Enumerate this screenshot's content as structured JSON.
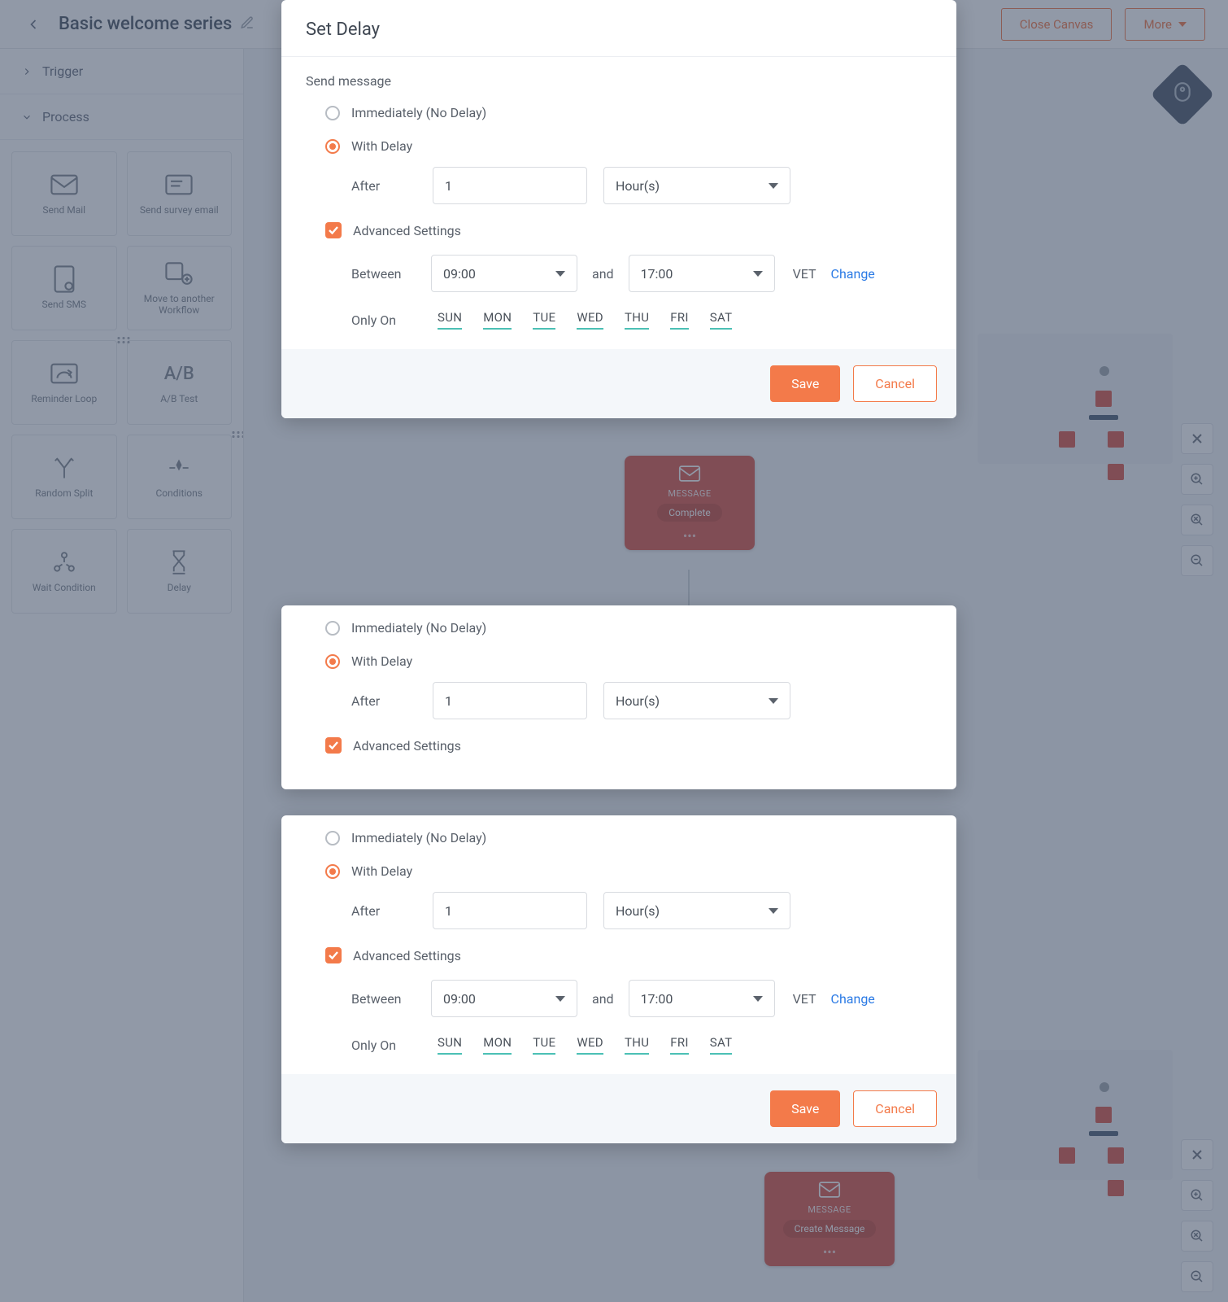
{
  "topbar": {
    "title": "Basic welcome series",
    "close_btn": "Close Canvas",
    "more_btn": "More"
  },
  "sidebar": {
    "section_trigger": "Trigger",
    "section_process": "Process",
    "tiles": [
      {
        "label": "Send Mail"
      },
      {
        "label": "Send survey email"
      },
      {
        "label": "Send SMS"
      },
      {
        "label": "Move to another Workflow"
      },
      {
        "label": "Reminder Loop"
      },
      {
        "label": "A/B Test"
      },
      {
        "label": "Random Split"
      },
      {
        "label": "Conditions"
      },
      {
        "label": "Wait Condition"
      },
      {
        "label": "Delay"
      }
    ],
    "ab_text": "A/B"
  },
  "canvas": {
    "msg_label": "MESSAGE",
    "pill_complete": "Complete",
    "pill_create": "Create Message"
  },
  "modal": {
    "title": "Set Delay",
    "send_msg": "Send message",
    "opt_immediate": "Immediately (No Delay)",
    "opt_delay": "With Delay",
    "after_lbl": "After",
    "after_val": "1",
    "after_unit": "Hour(s)",
    "adv_label": "Advanced Settings",
    "between_lbl": "Between",
    "t1": "09:00",
    "and": "and",
    "t2": "17:00",
    "tz": "VET",
    "change": "Change",
    "onlyon_lbl": "Only On",
    "days": [
      "SUN",
      "MON",
      "TUE",
      "WED",
      "THU",
      "FRI",
      "SAT"
    ],
    "save": "Save",
    "cancel": "Cancel"
  }
}
